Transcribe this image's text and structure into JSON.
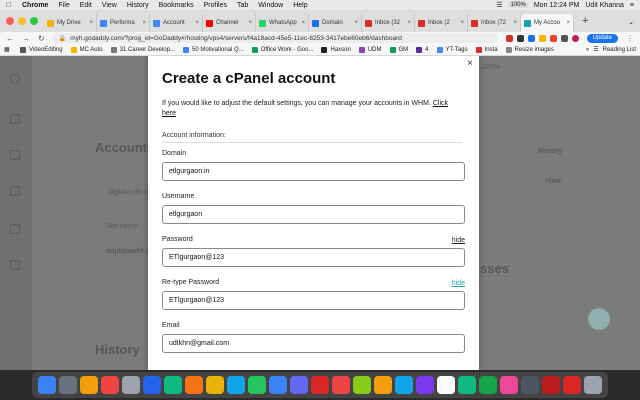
{
  "menubar": {
    "app": "Chrome",
    "items": [
      "File",
      "Edit",
      "View",
      "History",
      "Bookmarks",
      "Profiles",
      "Tab",
      "Window",
      "Help"
    ],
    "battery": "100%",
    "datetime": "Mon 12:24 PM",
    "user": "Udit Khanna"
  },
  "tabs": [
    {
      "label": "My Drive",
      "color": "#f4b400"
    },
    {
      "label": "Performa",
      "color": "#4285f4"
    },
    {
      "label": "Account",
      "color": "#4285f4"
    },
    {
      "label": "Channel",
      "color": "#ff0000"
    },
    {
      "label": "WhatsApp",
      "color": "#25d366"
    },
    {
      "label": "Domain",
      "color": "#1a73e8"
    },
    {
      "label": "Inbox (32",
      "color": "#d93025"
    },
    {
      "label": "Inbox (2",
      "color": "#d93025"
    },
    {
      "label": "Inbox (72",
      "color": "#d93025"
    },
    {
      "label": "My Accou",
      "color": "#16a3b0"
    }
  ],
  "toolbar": {
    "url": "myh.godaddy.com/?prog_id=GoDaddy#/hosting/vps4/servers/f4a18acd-45e5-11ec-8253-3417ebe60eb6/dashboard",
    "update_label": "Update"
  },
  "bookmarks": [
    {
      "label": "VideoEditing",
      "color": "#555555"
    },
    {
      "label": "MC Auto",
      "color": "#f4b400"
    },
    {
      "label": "31 Career Develop...",
      "color": "#777777"
    },
    {
      "label": "50 Motivational Q...",
      "color": "#4285f4"
    },
    {
      "label": "Office Work - Goo...",
      "color": "#0f9d58"
    },
    {
      "label": "Haxson",
      "color": "#222222"
    },
    {
      "label": "UDM",
      "color": "#8e44ad"
    },
    {
      "label": "GM",
      "color": "#0f9d58"
    },
    {
      "label": "4",
      "color": "#5b2c9c"
    },
    {
      "label": "YT-Tags",
      "color": "#4285f4"
    },
    {
      "label": "Insta",
      "color": "#d93025"
    },
    {
      "label": "Resize images",
      "color": "#888888"
    }
  ],
  "bookmarks_right": "Reading List",
  "background": {
    "accounts_title": "Accounts",
    "history_title": "History",
    "site_name": "Site name",
    "search_hint": "digitalaudit.co",
    "domain_row": "digitalaudit.co",
    "disk_text": "100%",
    "history_link": "History",
    "view_link": "View",
    "addresses_title": "sses"
  },
  "modal": {
    "close": "×",
    "title": "Create a cPanel account",
    "intro": "If you would like to adjust the default settings, you can manage your accounts in WHM.",
    "intro_link": "Click here",
    "section": "Account information:",
    "fields": {
      "domain": {
        "label": "Domain",
        "value": "etlgurgaon.in"
      },
      "username": {
        "label": "Username",
        "value": "etlgurgaon"
      },
      "password": {
        "label": "Password",
        "value": "ETlgurgaon@123",
        "toggle": "hide"
      },
      "retype": {
        "label": "Re-type Password",
        "value": "ETlgurgaon@123",
        "toggle": "hide"
      },
      "email": {
        "label": "Email",
        "value": "udtkhn@gmail.com"
      }
    }
  },
  "dock_colors": [
    "#3b82f6",
    "#6b7280",
    "#f59e0b",
    "#ef4444",
    "#9ca3af",
    "#2563eb",
    "#10b981",
    "#f97316",
    "#eab308",
    "#0ea5e9",
    "#22c55e",
    "#3b82f6",
    "#6366f1",
    "#dc2626",
    "#ef4444",
    "#84cc16",
    "#f59e0b",
    "#0ea5e9",
    "#7c3aed",
    "#f9fafb",
    "#10b981",
    "#16a34a",
    "#ec4899",
    "#4b5563",
    "#b91c1c",
    "#dc2626",
    "#9ca3af"
  ]
}
